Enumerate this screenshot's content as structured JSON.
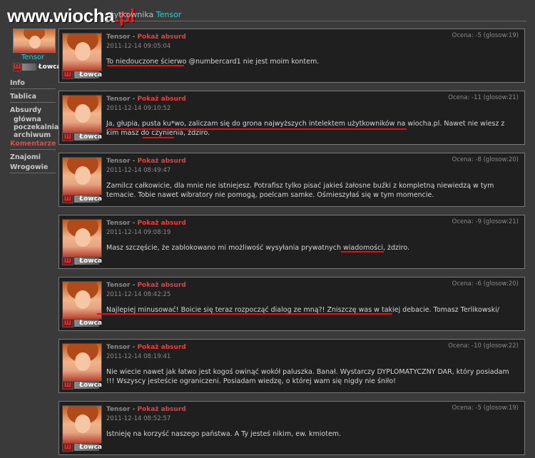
{
  "logo": {
    "text_main": "www.wiocha",
    "text_tld": ".pl"
  },
  "header": {
    "title_prefix": "żytkownika",
    "title_user": "Tensor"
  },
  "profile": {
    "name": "Tensor",
    "rank": "Łowca",
    "rank_icon": "Ш"
  },
  "nav": {
    "info": "Info",
    "tablica": "Tablica",
    "absurdy": "Absurdy",
    "glowna": "główna",
    "poczekalnia": "poczekalnia",
    "archiwum": "archiwum",
    "komentarze": "Komentarze",
    "znajomi": "Znajomi",
    "wrogowie": "Wrogowie"
  },
  "comments": [
    {
      "author": "Tensor",
      "sep": " - ",
      "link": "Pokaż absurd",
      "date": "2011-12-14 09:05:04",
      "rating": "Ocena: -5 (glosow:19)",
      "rank": "Łowca",
      "text": "To niedouczone ścierwo @numbercard1 nie jest moim kontem."
    },
    {
      "author": "Tensor",
      "sep": " - ",
      "link": "Pokaż absurd",
      "date": "2011-12-14 09:10:52",
      "rating": "Ocena: -11 (glosow:21)",
      "rank": "Łowca",
      "text": "Ja, głupia, pusta ku*wo, zaliczam się do grona najwyższych intelektem użytkowników na wiocha.pl. Nawet nie wiesz z kim masz do czynienia, żdziro."
    },
    {
      "author": "Tensor",
      "sep": " - ",
      "link": "Pokaż absurd",
      "date": "2011-12-14 08:49:47",
      "rating": "Ocena: -8 (glosow:20)",
      "rank": "Łowca",
      "text": "Zamilcz całkowicie, dla mnie nie istniejesz. Potrafisz tylko pisać jakieś żałosne buźki z kompletną niewiedzą w tym temacie. Tobie nawet wibratory nie pomogą, poelcam samke. Ośmieszyłaś się w tym momencie."
    },
    {
      "author": "Tensor",
      "sep": " - ",
      "link": "Pokaż absurd",
      "date": "2011-12-14 09:08:19",
      "rating": "Ocena: -9 (glosow:21)",
      "rank": "Łowca",
      "text": "Masz szczęście, że zablokowano mi możliwość wysyłania prywatnych wiadomości, żdziro."
    },
    {
      "author": "Tensor",
      "sep": " - ",
      "link": "Pokaż absurd",
      "date": "2011-12-14 08:42:25",
      "rating": "Ocena: -6 (glosow:20)",
      "rank": "Łowca",
      "text": "Najlepiej minusować! Boicie się teraz rozpocząć dialog ze mną?! Zniszczę was w takiej debacie. Tomasz Terlikowski/"
    },
    {
      "author": "Tensor",
      "sep": " - ",
      "link": "Pokaż absurd",
      "date": "2011-12-14 08:19:41",
      "rating": "Ocena: -10 (glosow:22)",
      "rank": "Łowca",
      "text": "Nie wiecie nawet jak łatwo jest kogoś owinąć wokół paluszka. Banał. Wystarczy DYPLOMATYCZNY DAR, który posiadam !!! Wszyscy jesteście ograniczeni. Posiadam wiedzę, o której wam się nigdy nie śniło!"
    },
    {
      "author": "Tensor",
      "sep": " - ",
      "link": "Pokaż absurd",
      "date": "2011-12-14 08:52:57",
      "rating": "Ocena: -5 (glosow:19)",
      "rank": "Łowca",
      "text": "Istnieję na korzyść naszego państwa. A Ty jesteś nikim, ew. kmiotem."
    }
  ],
  "colors": {
    "accent_user": "#2bd0d0",
    "link_red": "#e84040",
    "underline_red": "#e0101a"
  }
}
